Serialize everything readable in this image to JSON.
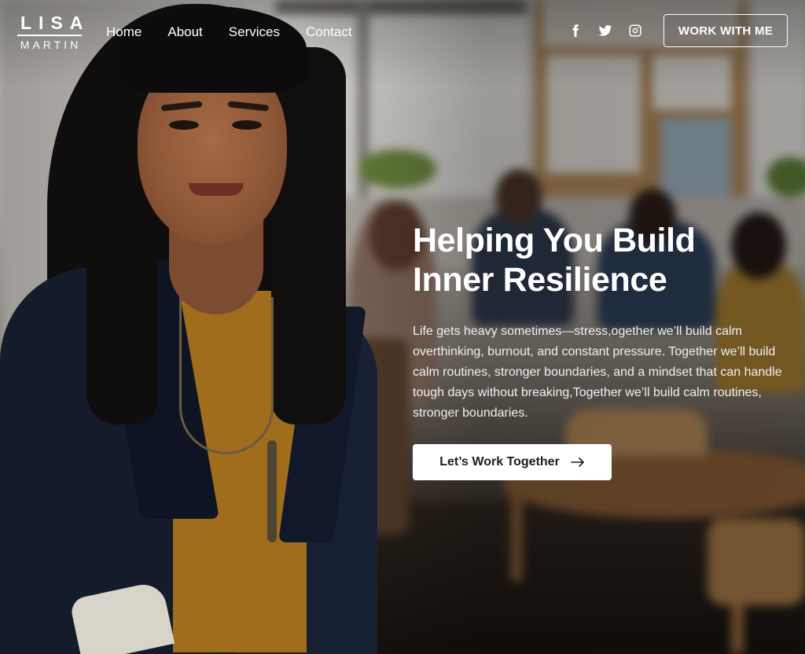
{
  "brand": {
    "first": "LISA",
    "last": "MARTIN"
  },
  "nav": [
    {
      "label": "Home"
    },
    {
      "label": "About"
    },
    {
      "label": "Services"
    },
    {
      "label": "Contact"
    }
  ],
  "social": [
    {
      "icon": "facebook-icon"
    },
    {
      "icon": "twitter-icon"
    },
    {
      "icon": "instagram-icon"
    }
  ],
  "header_cta": {
    "label": "WORK WITH ME"
  },
  "hero": {
    "headline_line1": "Helping You Build",
    "headline_line2": "Inner Resilience",
    "body": "Life gets heavy sometimes—stress,ogether we’ll build calm overthinking, burnout, and constant pressure. Together we’ll build calm routines, stronger boundaries, and a mindset that can handle tough days without breaking,Together we’ll build calm routines, stronger boundaries.",
    "cta_label": "Let’s Work Together"
  },
  "colors": {
    "text": "#ffffff",
    "button_bg": "#ffffff",
    "button_text": "#1d1d1d",
    "blazer": "#141b2a",
    "shirt": "#a06d1c"
  }
}
